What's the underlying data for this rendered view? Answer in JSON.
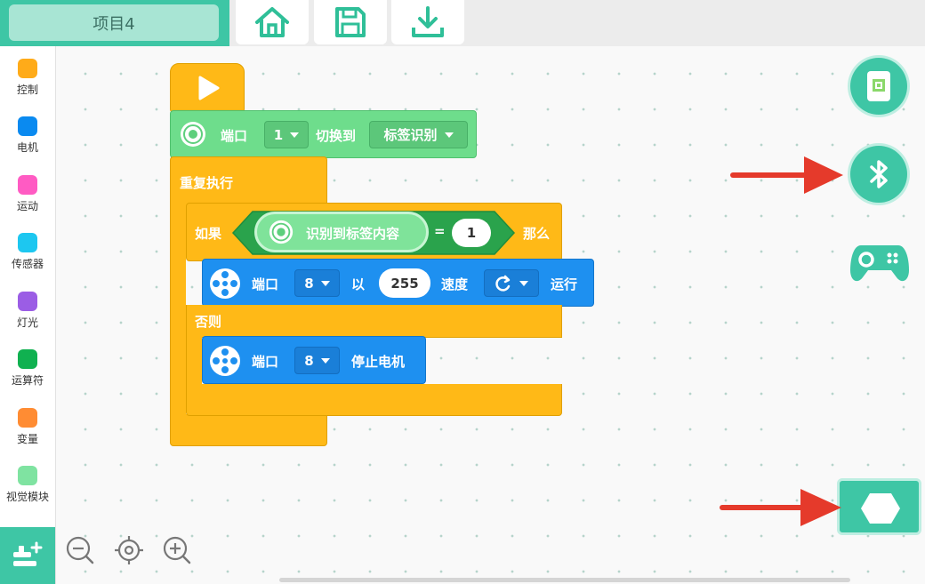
{
  "header": {
    "project_name": "项目4"
  },
  "toolbar": {
    "home_icon": "home-icon",
    "save_icon": "save-icon",
    "download_icon": "download-icon"
  },
  "sidebar": {
    "categories": [
      {
        "label": "控制",
        "color": "#FFAB19"
      },
      {
        "label": "电机",
        "color": "#0A8AF0"
      },
      {
        "label": "运动",
        "color": "#FF5BC3"
      },
      {
        "label": "传感器",
        "color": "#1DC7F0"
      },
      {
        "label": "灯光",
        "color": "#9B5DE5"
      },
      {
        "label": "运算符",
        "color": "#10B150"
      },
      {
        "label": "变量",
        "color": "#FF8C33"
      },
      {
        "label": "视觉模块",
        "color": "#7FE3A1"
      }
    ]
  },
  "blocks": {
    "switch": {
      "port_label": "端口",
      "port_value": "1",
      "switch_label": "切换到",
      "mode_value": "标签识别"
    },
    "repeat": {
      "label": "重复执行"
    },
    "if": {
      "if_label": "如果",
      "sensor_label": "识别到标签内容",
      "operator": "=",
      "compare_value": "1",
      "then_label": "那么"
    },
    "motor_run": {
      "port_label": "端口",
      "port_value": "8",
      "with_label": "以",
      "speed_value": "255",
      "speed_label": "速度",
      "run_label": "运行"
    },
    "else": {
      "label": "否则"
    },
    "motor_stop": {
      "port_label": "端口",
      "port_value": "8",
      "stop_label": "停止电机"
    }
  },
  "colors": {
    "accent": "#3EC6A5",
    "control": "#FFAB19",
    "motor": "#1E90F0",
    "vision": "#6EDD8C",
    "operator": "#2AA34C",
    "arrow": "#E53A2B"
  }
}
